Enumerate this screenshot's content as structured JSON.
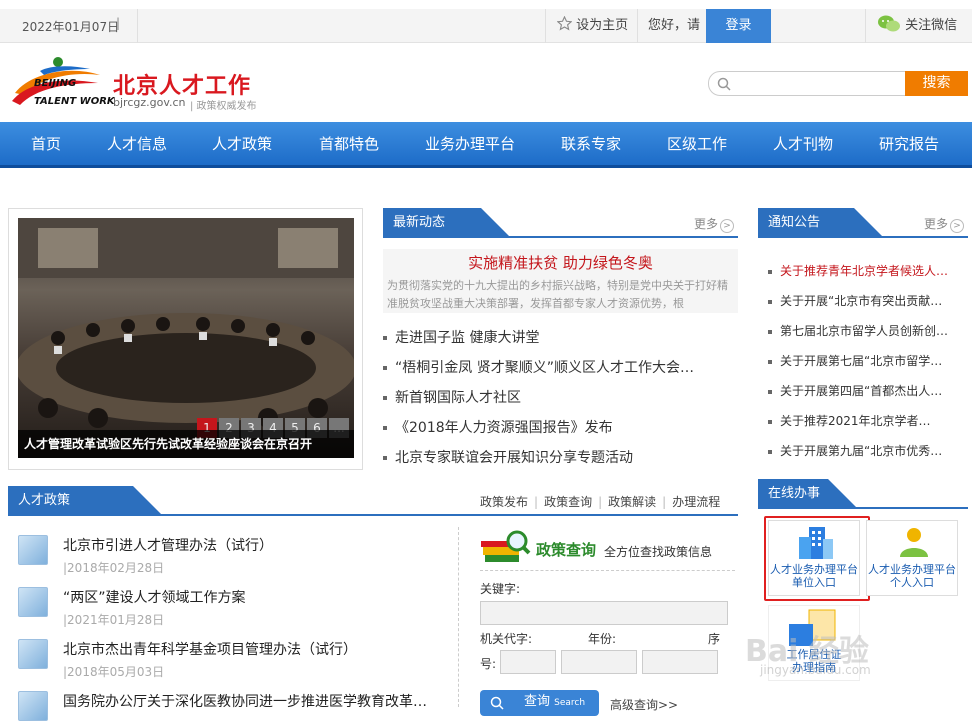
{
  "topbar": {
    "date": "2022年01月07日",
    "separator": "|",
    "set_home": "设为主页",
    "greeting": "您好，请",
    "login": "登录",
    "wechat": "关注微信"
  },
  "header": {
    "logo_en_1": "BEIJING",
    "logo_en_2": "TALENT WORK",
    "logo_cn": "北京人才工作",
    "logo_url": "bjrcgz.gov.cn",
    "logo_sub": "| 政策权威发布",
    "search_placeholder": "",
    "search_button": "搜索"
  },
  "nav": [
    "首页",
    "人才信息",
    "人才政策",
    "首都特色",
    "业务办理平台",
    "联系专家",
    "区级工作",
    "人才刊物",
    "研究报告"
  ],
  "slider": {
    "caption": "人才管理改革试验区先行先试改革经验座谈会在京召开",
    "pages": [
      "1",
      "2",
      "3",
      "4",
      "5",
      "6",
      "..."
    ]
  },
  "news": {
    "title": "最新动态",
    "more": "更多",
    "headline": "实施精准扶贫 助力绿色冬奥",
    "headline_desc": "为贯彻落实党的十九大提出的乡村振兴战略，特别是党中央关于打好精准脱贫攻坚战重大决策部署，发挥首都专家人才资源优势，根",
    "items": [
      "走进国子监 健康大讲堂",
      "“梧桐引金凤 贤才聚顺义”顺义区人才工作大会…",
      "新首钢国际人才社区",
      "《2018年人力资源强国报告》发布",
      "北京专家联谊会开展知识分享专题活动"
    ]
  },
  "notice": {
    "title": "通知公告",
    "more": "更多",
    "items": [
      "关于推荐青年北京学者候选人…",
      "关于开展“北京市有突出贡献…",
      "第七届北京市留学人员创新创…",
      "关于开展第七届“北京市留学…",
      "关于开展第四届“首都杰出人…",
      "关于推荐2021年北京学者…",
      "关于开展第九届“北京市优秀…"
    ]
  },
  "policy": {
    "title": "人才政策",
    "links": [
      "政策发布",
      "政策查询",
      "政策解读",
      "办理流程"
    ],
    "items": [
      {
        "title": "北京市引进人才管理办法（试行）",
        "date": "|2018年02月28日"
      },
      {
        "title": "“两区”建设人才领域工作方案",
        "date": "|2021年01月28日"
      },
      {
        "title": "北京市杰出青年科学基金项目管理办法（试行）",
        "date": "|2018年05月03日"
      },
      {
        "title": "国务院办公厅关于深化医教协同进一步推进医学教育改革…",
        "date": ""
      }
    ]
  },
  "policy_query": {
    "title": "政策查询",
    "subtitle": "全方位查找政策信息",
    "keyword_label": "关键字:",
    "org_code_label": "机关代字:",
    "year_label": "年份:",
    "seq_label_1": "序",
    "seq_label_2": "号:",
    "query_button": "查询",
    "query_button_en": "Search",
    "advanced": "高级查询>>"
  },
  "online": {
    "title": "在线办事",
    "services": [
      {
        "line1": "人才业务办理平台",
        "line2": "单位入口"
      },
      {
        "line1": "人才业务办理平台",
        "line2": "个人入口"
      },
      {
        "line1": "工作居住证",
        "line2": "办理指南"
      }
    ]
  },
  "watermark": {
    "main": "Bai 经验",
    "url": "jingyan.baidu.com"
  },
  "colors": {
    "nav_blue": "#1d6cc8",
    "accent_red": "#c4161c",
    "search_orange": "#f07c00",
    "query_green": "#2c8b2c"
  }
}
